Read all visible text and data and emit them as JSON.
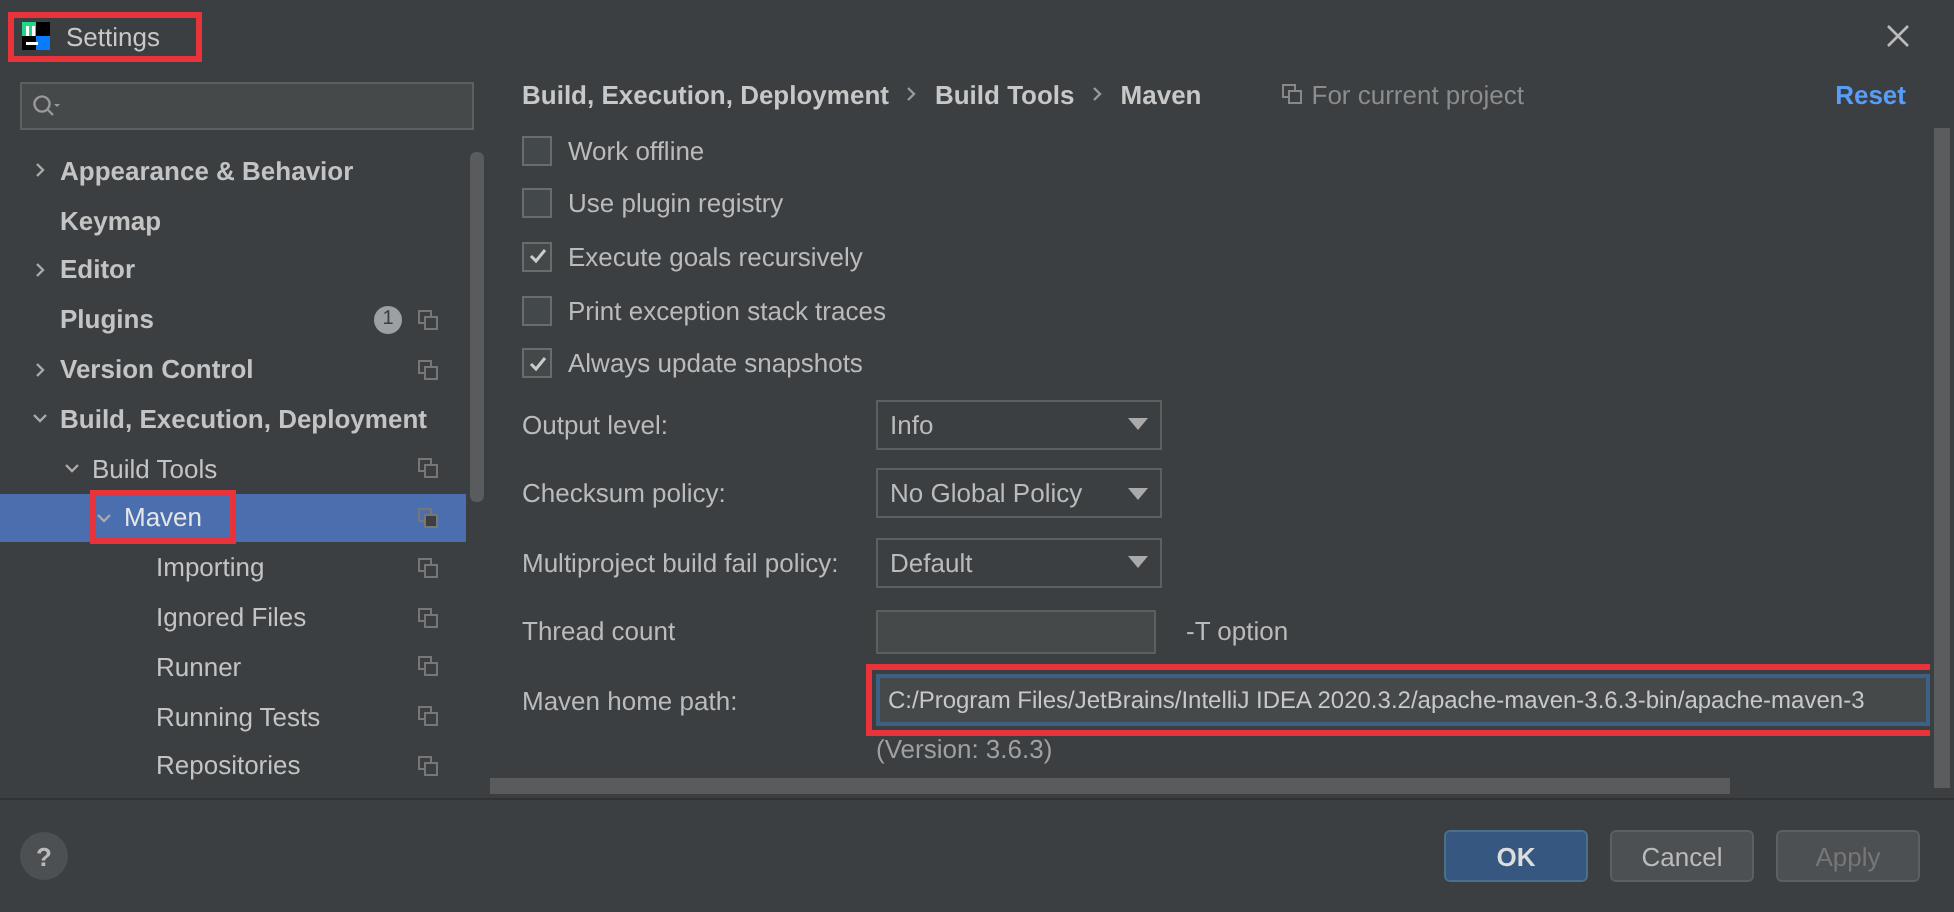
{
  "window": {
    "title": "Settings",
    "highlighted": true
  },
  "sidebar": {
    "items": [
      {
        "label": "Appearance & Behavior",
        "expanded": false,
        "selected": false,
        "highlighted": false,
        "project_level": false
      },
      {
        "label": "Keymap",
        "selected": false,
        "highlighted": false,
        "project_level": false
      },
      {
        "label": "Editor",
        "expanded": false,
        "selected": false,
        "highlighted": false,
        "project_level": false
      },
      {
        "label": "Plugins",
        "selected": false,
        "highlighted": false,
        "project_level": true,
        "badge": "1"
      },
      {
        "label": "Version Control",
        "expanded": false,
        "selected": false,
        "highlighted": false,
        "project_level": true
      },
      {
        "label": "Build, Execution, Deployment",
        "expanded": true,
        "selected": false,
        "highlighted": false,
        "project_level": false,
        "children": [
          {
            "label": "Build Tools",
            "expanded": true,
            "selected": false,
            "highlighted": false,
            "project_level": true,
            "children": [
              {
                "label": "Maven",
                "expanded": true,
                "selected": true,
                "highlighted": true,
                "project_level": true,
                "children": [
                  {
                    "label": "Importing",
                    "selected": false,
                    "highlighted": false,
                    "project_level": true
                  },
                  {
                    "label": "Ignored Files",
                    "selected": false,
                    "highlighted": false,
                    "project_level": true
                  },
                  {
                    "label": "Runner",
                    "selected": false,
                    "highlighted": false,
                    "project_level": true
                  },
                  {
                    "label": "Running Tests",
                    "selected": false,
                    "highlighted": false,
                    "project_level": true
                  },
                  {
                    "label": "Repositories",
                    "selected": false,
                    "highlighted": false,
                    "project_level": true
                  }
                ]
              }
            ]
          }
        ]
      }
    ]
  },
  "breadcrumb": [
    "Build, Execution, Deployment",
    "Build Tools",
    "Maven"
  ],
  "scope_note": "For current project",
  "reset_link": "Reset",
  "options": [
    {
      "kind": "checkbox",
      "label": "Work offline",
      "checked": false
    },
    {
      "kind": "checkbox",
      "label": "Use plugin registry",
      "checked": false
    },
    {
      "kind": "checkbox",
      "label": "Execute goals recursively",
      "checked": true
    },
    {
      "kind": "checkbox",
      "label": "Print exception stack traces",
      "checked": false
    },
    {
      "kind": "checkbox",
      "label": "Always update snapshots",
      "checked": true
    },
    {
      "kind": "dropdown",
      "label": "Output level:",
      "value": "Info"
    },
    {
      "kind": "dropdown",
      "label": "Checksum policy:",
      "value": "No Global Policy"
    },
    {
      "kind": "dropdown",
      "label": "Multiproject build fail policy:",
      "value": "Default"
    },
    {
      "kind": "text",
      "label": "Thread count",
      "suffix": "-T option"
    },
    {
      "kind": "path",
      "label": "Maven home path:",
      "value": "C:/Program Files/JetBrains/IntelliJ IDEA 2020.3.2/apache-maven-3.6.3-bin/apache-maven-3",
      "highlighted": true,
      "note": "(Version: 3.6.3)"
    }
  ],
  "help_button": "?",
  "buttons": [
    {
      "label": "OK",
      "kind": "default",
      "disabled": false
    },
    {
      "label": "Cancel",
      "kind": "normal",
      "disabled": false
    },
    {
      "label": "Apply",
      "kind": "normal",
      "disabled": true
    }
  ]
}
